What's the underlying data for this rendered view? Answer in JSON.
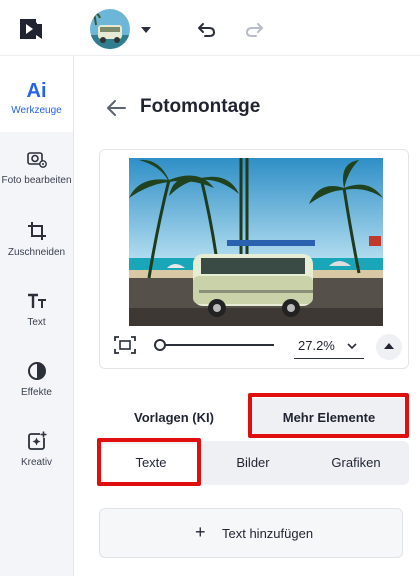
{
  "header": {
    "undo_icon": "undo-arrow-icon",
    "redo_icon": "redo-arrow-icon"
  },
  "sidebar": {
    "items": [
      {
        "glyph": "Ai",
        "label": "Werkzeuge",
        "icon": "ai-tools-icon",
        "active": true
      },
      {
        "label": "Foto bearbeiten",
        "icon": "photo-edit-icon"
      },
      {
        "label": "Zuschneiden",
        "icon": "crop-icon"
      },
      {
        "label": "Text",
        "icon": "text-icon"
      },
      {
        "label": "Effekte",
        "icon": "contrast-effects-icon"
      },
      {
        "label": "Kreativ",
        "icon": "sparkle-add-icon"
      }
    ]
  },
  "main": {
    "title": "Fotomontage",
    "zoom": "27.2%",
    "zoom_progress": 0.0,
    "tabs": [
      {
        "label": "Vorlagen (KI)"
      },
      {
        "label": "Mehr Elemente"
      }
    ],
    "segments": [
      {
        "label": "Texte"
      },
      {
        "label": "Bilder"
      },
      {
        "label": "Grafiken"
      }
    ],
    "add_text": {
      "label": "Text hinzufügen",
      "icon": "plus-icon"
    }
  },
  "colors": {
    "accent": "#2563eb",
    "highlight": "#e10e0e"
  }
}
